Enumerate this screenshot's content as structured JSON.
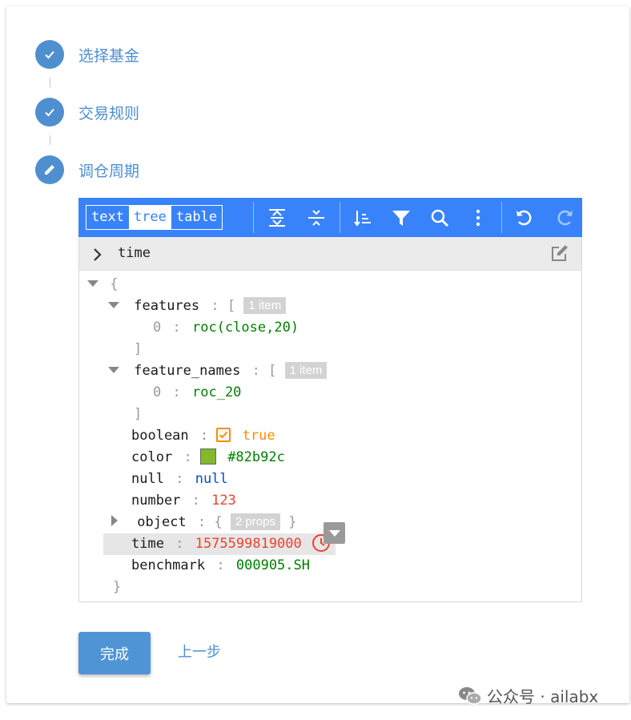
{
  "steps": [
    {
      "label": "选择基金",
      "state": "done",
      "icon": "check-icon"
    },
    {
      "label": "交易规则",
      "state": "done",
      "icon": "check-icon"
    },
    {
      "label": "调仓周期",
      "state": "active",
      "icon": "pencil-icon"
    }
  ],
  "editor": {
    "modes": [
      "text",
      "tree",
      "table"
    ],
    "active_mode": "tree",
    "toolbar_icons": [
      "expand-all-icon",
      "collapse-all-icon",
      "sort-icon",
      "filter-icon",
      "search-icon",
      "more-icon",
      "undo-icon",
      "redo-icon"
    ],
    "nav_path": "time",
    "tree": {
      "open_brace": "{",
      "close_brace": "}",
      "features_key": "features",
      "features_badge": "1 item",
      "features_index": "0",
      "features_value": "roc(close,20)",
      "feature_names_key": "feature_names",
      "feature_names_badge": "1 item",
      "feature_names_index": "0",
      "feature_names_value": "roc_20",
      "open_bracket": "[",
      "close_bracket": "]",
      "colon": ":",
      "boolean_key": "boolean",
      "boolean_value": "true",
      "color_key": "color",
      "color_value": "#82b92c",
      "null_key": "null",
      "null_value": "null",
      "number_key": "number",
      "number_value": "123",
      "object_key": "object",
      "object_badge": "2 props",
      "time_key": "time",
      "time_value": "1575599819000",
      "benchmark_key": "benchmark",
      "benchmark_value": "000905.SH"
    }
  },
  "buttons": {
    "done": "完成",
    "prev": "上一步"
  },
  "watermark": "公众号 · ailabx",
  "colors": {
    "accent": "#4f8fd0",
    "menu": "#3883fa",
    "string": "#008000",
    "number": "#ee422e",
    "boolean": "#ff8c00",
    "null": "#004ed0"
  }
}
